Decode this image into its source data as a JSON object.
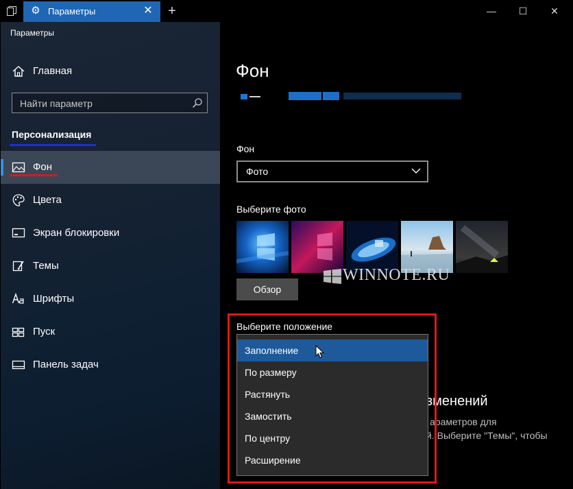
{
  "window": {
    "tab_title": "Параметры",
    "tab_icon": "gear-icon",
    "new_tab_symbol": "+",
    "controls": {
      "minimize": "—",
      "maximize": "☐",
      "close": "✕"
    }
  },
  "sidebar": {
    "app_title": "Параметры",
    "home_label": "Главная",
    "search_placeholder": "Найти параметр",
    "section_title": "Персонализация",
    "items": [
      {
        "label": "Фон",
        "icon": "picture-icon",
        "active": true
      },
      {
        "label": "Цвета",
        "icon": "palette-icon"
      },
      {
        "label": "Экран блокировки",
        "icon": "lock-screen-icon"
      },
      {
        "label": "Темы",
        "icon": "brush-icon"
      },
      {
        "label": "Шрифты",
        "icon": "font-icon"
      },
      {
        "label": "Пуск",
        "icon": "start-icon"
      },
      {
        "label": "Панель задач",
        "icon": "taskbar-icon"
      }
    ]
  },
  "main": {
    "page_title": "Фон",
    "background_label": "Фон",
    "background_value": "Фото",
    "choose_photo_label": "Выберите фото",
    "browse_label": "Обзор",
    "watermark": "WINNOTE.RU",
    "position_label": "Выберите положение",
    "position_options": [
      "Заполнение",
      "По размеру",
      "Растянуть",
      "Замостить",
      "По центру",
      "Расширение"
    ],
    "position_selected": "Заполнение",
    "partial_heading": "зменений",
    "partial_text1": "араметров для",
    "partial_text2": "й. Выберите \"Темы\", чтобы"
  },
  "colors": {
    "accent": "#1f67b5",
    "highlight_red": "#e01818",
    "highlight_blue": "#1c2fd6",
    "selected_option": "#1e5a9a"
  }
}
